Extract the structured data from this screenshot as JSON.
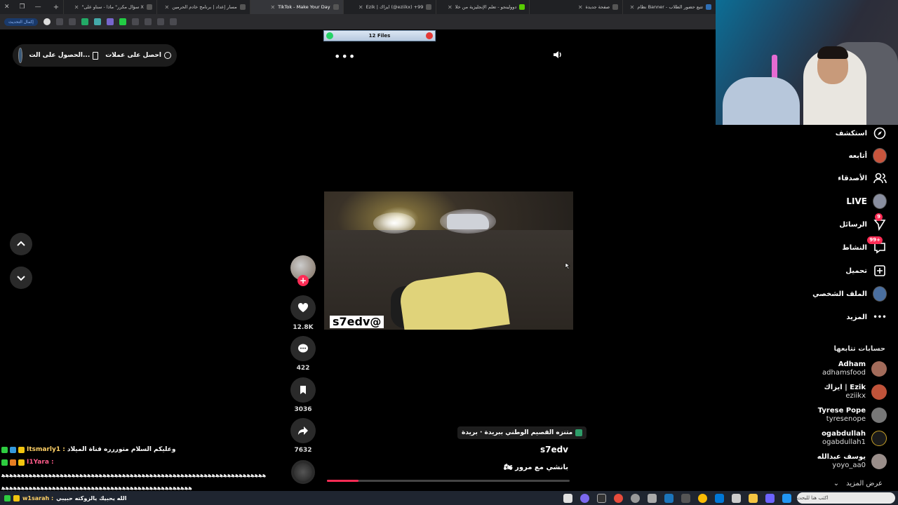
{
  "browser": {
    "tabs": [
      {
        "title": "نظام Banner - تتبع حضور الطلاب",
        "active": false
      },
      {
        "title": "صفحة جديدة",
        "active": false
      },
      {
        "title": "دوولينجو - تعلم الإنجليزية من خلا",
        "active": false
      },
      {
        "title": "Ezik | ايزاك (@eziikx) +99",
        "active": false
      },
      {
        "title": "TikTok - Make Your Day",
        "active": true
      },
      {
        "title": "مسار إعداد | برنامج خادم الحرمين",
        "active": false
      },
      {
        "title": "\"سؤال مكرر\" ماذا - سناو على X",
        "active": false
      }
    ],
    "update_button": "إكمال التحديث"
  },
  "header": {
    "get_coins": "احصل على عملات",
    "get_app": "الحصول على الت..."
  },
  "files_notice": {
    "label": "12 Files"
  },
  "video": {
    "watermark": "s7edv@",
    "progress": 0.13
  },
  "actions": {
    "likes": "12.8K",
    "comments": "422",
    "saves": "3036",
    "shares": "7632"
  },
  "info": {
    "location": "متنزه القصيم الوطني ببريدة · بريدة",
    "author": "s7edv",
    "description": "بانشي مع مرور 🏍"
  },
  "sidebar": {
    "items": [
      {
        "label": "استكشف",
        "icon": "compass-icon"
      },
      {
        "label": "أتابعه",
        "icon": "following-avatar-icon"
      },
      {
        "label": "الأصدقاء",
        "icon": "friends-icon"
      },
      {
        "label": "LIVE",
        "icon": "live-avatar-icon"
      },
      {
        "label": "الرسائل",
        "icon": "send-icon",
        "badge": "9"
      },
      {
        "label": "النشاط",
        "icon": "activity-icon",
        "badge": "+99"
      },
      {
        "label": "تحميل",
        "icon": "upload-icon"
      },
      {
        "label": "الملف الشخصي",
        "icon": "profile-avatar-icon"
      },
      {
        "label": "المزيد",
        "icon": "more-icon"
      }
    ],
    "following_title": "حسابات تتابعها",
    "following": [
      {
        "name": "Adham",
        "handle": "adhamsfood"
      },
      {
        "name": "Ezik | ايزاك",
        "handle": "eziikx"
      },
      {
        "name": "Tyrese Pope",
        "handle": "tyresenope"
      },
      {
        "name": "ogabdullah",
        "handle": "ogabdullah1"
      },
      {
        "name": "يوسف عبدالله",
        "handle": "yoyo_aa0"
      }
    ],
    "see_more": "عرض المزيد"
  },
  "chat": [
    {
      "name": "Itsmarly1 :",
      "message": "وعليكم السلام متوررره قناة الميلاد"
    },
    {
      "name": "I1Yara :",
      "message": ""
    },
    {
      "name": "",
      "message": "ﻫﻫﻫﻫﻫﻫﻫﻫﻫﻫﻫﻫﻫﻫﻫﻫﻫﻫﻫﻫﻫﻫﻫﻫﻫﻫﻫﻫﻫﻫﻫﻫﻫﻫﻫﻫﻫﻫﻫﻫﻫﻫﻫﻫﻫﻫﻫﻫﻫﻫﻫﻫﻫﻫﻫﻫﻫﻫﻫﻫﻫﻫﻫﻫﻫﻫﻫﻫ"
    },
    {
      "name": "",
      "message": "ﻫﻫﻫﻫﻫﻫﻫﻫﻫﻫﻫﻫﻫﻫﻫﻫﻫﻫﻫﻫﻫﻫﻫﻫﻫﻫﻫﻫﻫﻫﻫﻫﻫﻫﻫﻫﻫﻫﻫﻫﻫﻫﻫﻫﻫﻫﻫﻫﻫ"
    },
    {
      "name": "w1sarah :",
      "message": "الله يحبيك يالزوكته حبيبي"
    }
  ],
  "taskbar": {
    "search_placeholder": "اكتب هنا للبحث"
  }
}
